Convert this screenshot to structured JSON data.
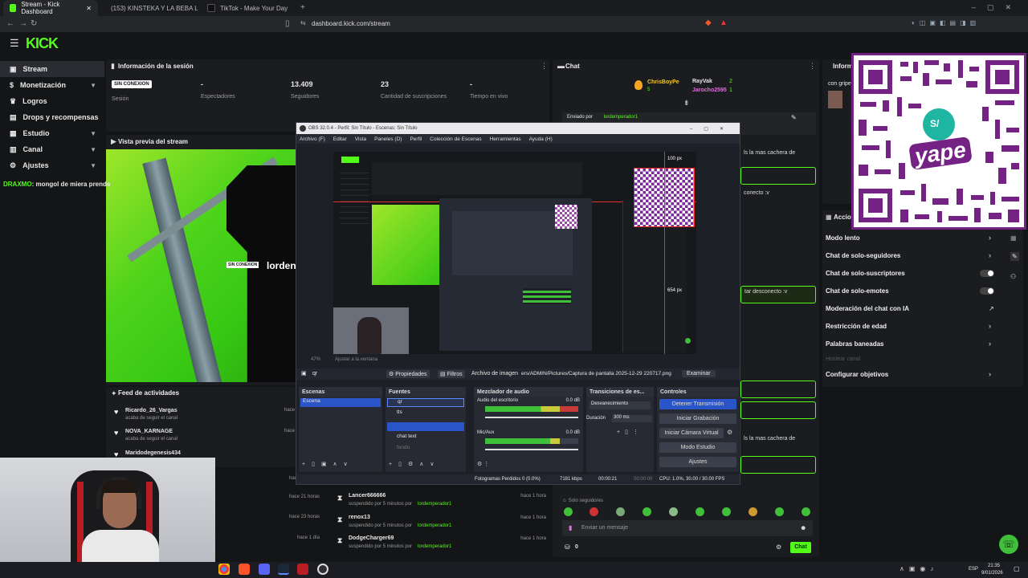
{
  "browser": {
    "tabs": [
      {
        "title": "Stream - Kick Dashboard"
      },
      {
        "title": "(153) KINSTEKA Y LA BEBA LOS REA"
      },
      {
        "title": "TikTok - Make Your Day"
      }
    ],
    "url": "dashboard.kick.com/stream"
  },
  "kick": {
    "logo": "KICK",
    "nav": [
      {
        "label": "Stream",
        "icon": "broadcast-icon"
      },
      {
        "label": "Monetización",
        "icon": "money-icon"
      },
      {
        "label": "Logros",
        "icon": "trophy-icon"
      },
      {
        "label": "Drops y recompensas",
        "icon": "gift-icon"
      },
      {
        "label": "Estudio",
        "icon": "studio-icon"
      },
      {
        "label": "Canal",
        "icon": "channel-icon"
      },
      {
        "label": "Ajustes",
        "icon": "gear-icon"
      }
    ],
    "session": {
      "title": "Información de la sesión",
      "status_badge": "SIN CONEXION",
      "session_label": "Sesión",
      "stats": [
        {
          "value": "-",
          "label": "Espectadores"
        },
        {
          "value": "13.409",
          "label": "Seguidores"
        },
        {
          "value": "23",
          "label": "Cantidad de suscripciones"
        },
        {
          "value": "-",
          "label": "Tiempo en vivo"
        }
      ]
    },
    "preview": {
      "title": "Vista previa del stream",
      "chat_overlay_user": "DRAXMO",
      "chat_overlay_text": ": mongol de miera prende",
      "badge": "SIN CONEXION",
      "name": "lorden"
    },
    "activity": {
      "title": "Feed de actividades",
      "items": [
        {
          "name": "Ricardo_26_Vargas",
          "sub": "acaba de seguir el canal",
          "time": "hace"
        },
        {
          "name": "NOVA_KARNAGE",
          "sub": "acaba de seguir el canal",
          "time": "hace"
        },
        {
          "name": "Maridodegenesis434",
          "sub": "",
          "time": ""
        }
      ],
      "times_right": [
        "hace 17 horas",
        "hace 21 horas",
        "hace 23 horas",
        "hace 1 día"
      ],
      "mod_items": [
        {
          "name": "Lancer666666",
          "sub": "suspendido por 5 minutos por",
          "mod": "lordemperador1",
          "time": "hace 1 hora"
        },
        {
          "name": "renox13",
          "sub": "suspendido por 5 minutos por",
          "mod": "lordemperador1",
          "time": "hace 1 hora"
        },
        {
          "name": "DodgeCharger69",
          "sub": "suspendido por 5 minutos por",
          "mod": "lordemperador1",
          "time": "hace 1 hora"
        }
      ]
    },
    "chat": {
      "title": "Chat",
      "top": [
        {
          "name": "ChrisBoyPe",
          "count": "5"
        },
        {
          "name": "RayVak",
          "count": "2"
        },
        {
          "name": "Jarocho2595",
          "count": "1"
        }
      ],
      "pinned_by": "Enviado por",
      "pinned_user": "lordemperador1",
      "followers_only": "Solo seguidores",
      "placeholder": "Enviar un mensaje",
      "count": "0",
      "send": "Chat"
    },
    "info_partial": {
      "title": "Inform",
      "text": "con gripe"
    },
    "pills": [
      "ls la mas cachera de",
      "conecto :v",
      "tar desconecto :v",
      "ls la mas cachera de"
    ],
    "actions": {
      "title": "Accio",
      "items": [
        {
          "label": "Modo lento",
          "control": "chevron"
        },
        {
          "label": "Chat de solo-seguidores",
          "control": "chevron"
        },
        {
          "label": "Chat de solo-suscriptores",
          "control": "toggle"
        },
        {
          "label": "Chat de solo-emotes",
          "control": "toggle"
        },
        {
          "label": "Moderación del chat con IA",
          "control": "link"
        },
        {
          "label": "Restricción de edad",
          "control": "chevron"
        },
        {
          "label": "Palabras baneadas",
          "control": "chevron"
        },
        {
          "label": "Hostear canal",
          "control": "none"
        },
        {
          "label": "Configurar objetivos",
          "control": "chevron"
        }
      ]
    }
  },
  "obs": {
    "title": "OBS 32.0.4 - Perfil: Sin Título - Escenas: Sin Título",
    "menu": [
      "Archivo (F)",
      "Editar",
      "Vista",
      "Paneles (D)",
      "Perfil",
      "Colección de Escenas",
      "Herramientas",
      "Ayuda (H)"
    ],
    "measure_top": "100 px",
    "measure_right": "654 px",
    "zoom": "47%",
    "fit_label": "Ajustar a la ventana",
    "source_name": "qr",
    "props": "Propiedades",
    "filters": "Filtros",
    "image_file_label": "Archivo de imagen",
    "image_path": "ers/ADMIN/Pictures/Captura de pantalla 2025-12-29 220717.png",
    "browse": "Examinar",
    "docks": {
      "scenes": "Escenas",
      "sources": "Fuentes",
      "mixer": "Mezclador de audio",
      "transitions": "Transiciones de es...",
      "controls": "Controles"
    },
    "scene": "Escena",
    "sources": [
      "qr",
      "tts",
      "",
      "chat text",
      "fondo"
    ],
    "mixer": [
      {
        "name": "Audio del escritorio",
        "db": "0.0 dB"
      },
      {
        "name": "Mic/Aux",
        "db": "0.0 dB"
      }
    ],
    "transition": "Desvanecimiento",
    "duration_label": "Duración",
    "duration": "300 ms",
    "controls": [
      "Detener Transmisión",
      "Iniciar Grabación",
      "Iniciar Cámara Virtual",
      "Modo Estudio",
      "Ajustes"
    ],
    "status": {
      "frames": "Fotogramas Perdidos 0 (0.0%)",
      "kbps": "7181 kbps",
      "live": "00:00:21",
      "rec": "00:00:00",
      "cpu": "CPU: 1.0%, 30.00 / 30.00 FPS"
    }
  },
  "qr_overlay": {
    "brand": "yape",
    "symbol": "S/"
  },
  "taskbar": {
    "lang": "ESP",
    "time": "21:35",
    "date": "9/01/2026"
  },
  "colors": {
    "kick_green": "#53fc18",
    "yape_purple": "#742284",
    "obs_blue": "#2a55c9"
  }
}
